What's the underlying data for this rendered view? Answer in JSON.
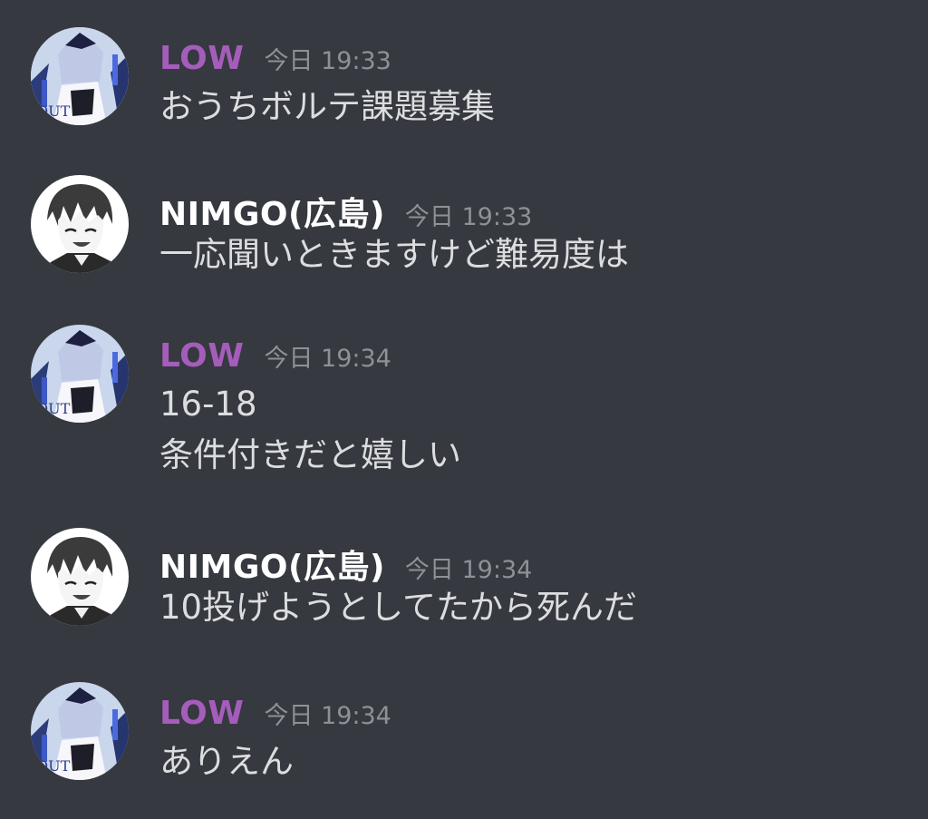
{
  "messages": [
    {
      "author": "LOW",
      "timestamp": "今日 19:33",
      "lines": [
        "おうちボルテ課題募集"
      ]
    },
    {
      "author": "NIMGO(広島)",
      "timestamp": "今日 19:33",
      "lines": [
        "一応聞いときますけど難易度は"
      ]
    },
    {
      "author": "LOW",
      "timestamp": "今日 19:34",
      "lines": [
        "16-18",
        "条件付きだと嬉しい"
      ]
    },
    {
      "author": "NIMGO(広島)",
      "timestamp": "今日 19:34",
      "lines": [
        "10投げようとしてたから死んだ"
      ]
    },
    {
      "author": "LOW",
      "timestamp": "今日 19:34",
      "lines": [
        "ありえん"
      ]
    }
  ],
  "colors": {
    "background": "#36393f",
    "low_name": "#a55dbb",
    "nimgo_name": "#ffffff",
    "timestamp": "#8e9297",
    "message_text": "#dcddde"
  },
  "icons": {
    "low_avatar": "anime-girl-avatar-icon",
    "nimgo_avatar": "manga-boy-avatar-icon"
  }
}
